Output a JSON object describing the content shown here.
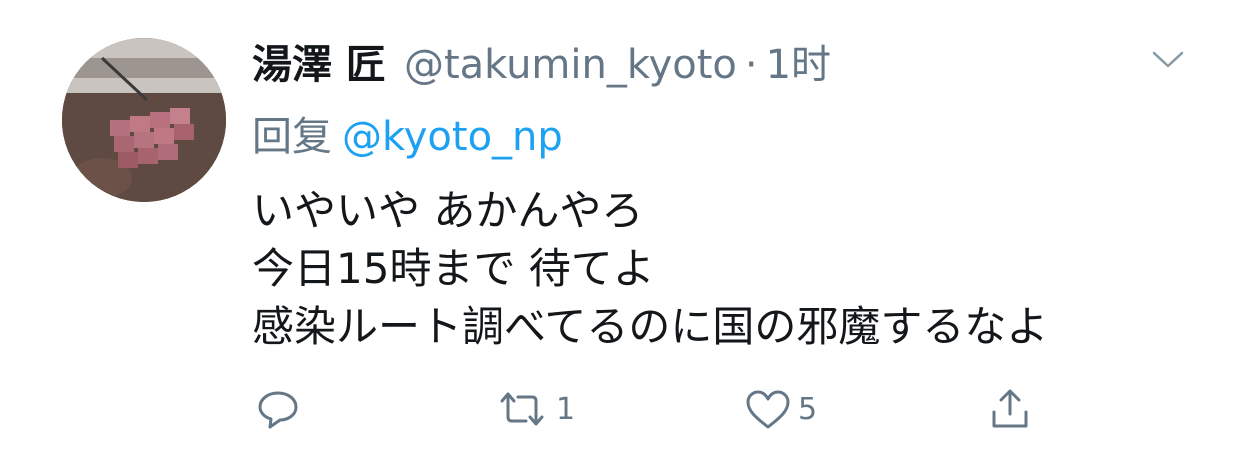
{
  "tweet": {
    "author": {
      "display_name": "湯澤 匠",
      "handle": "@takumin_kyoto",
      "avatar": "steak-grill-photo"
    },
    "separator": "·",
    "time": "1时",
    "menu_icon": "chevron-down-icon",
    "reply": {
      "label": "回复",
      "handle": "@kyoto_np"
    },
    "body_lines": [
      "いやいや あかんやろ",
      "今日15時まで 待てよ",
      "感染ルート調べてるのに国の邪魔するなよ"
    ],
    "actions": {
      "reply_icon": "comment-icon",
      "retweet_icon": "retweet-icon",
      "retweet_count": "1",
      "like_icon": "heart-icon",
      "like_count": "5",
      "share_icon": "share-icon"
    }
  },
  "colors": {
    "text_primary": "#14171a",
    "text_secondary": "#657786",
    "link": "#1da1f2",
    "icon": "#657786"
  }
}
